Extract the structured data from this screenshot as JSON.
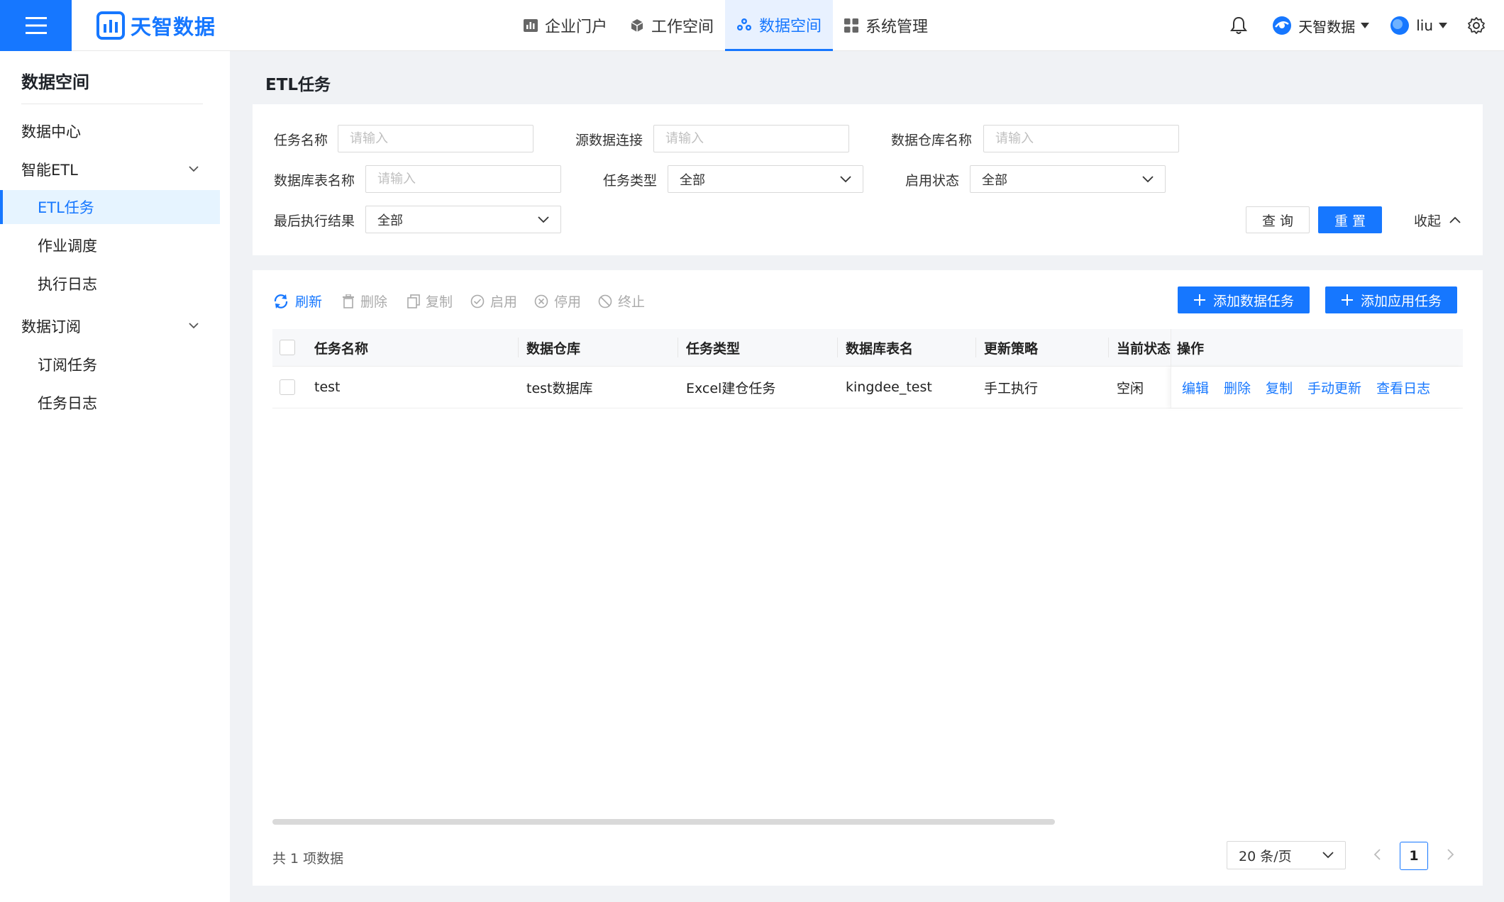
{
  "brand": {
    "name": "天智数据"
  },
  "nav": [
    {
      "label": "企业门户",
      "icon": "bar-chart-icon"
    },
    {
      "label": "工作空间",
      "icon": "cube-icon"
    },
    {
      "label": "数据空间",
      "icon": "data-nodes-icon",
      "active": true
    },
    {
      "label": "系统管理",
      "icon": "grid-icon"
    }
  ],
  "header_right": {
    "org": "天智数据",
    "user": "liu"
  },
  "sidebar": {
    "title": "数据空间",
    "items": [
      {
        "label": "数据中心",
        "level": 1
      },
      {
        "label": "智能ETL",
        "level": 1,
        "expandable": true
      },
      {
        "label": "ETL任务",
        "level": 2,
        "active": true
      },
      {
        "label": "作业调度",
        "level": 2
      },
      {
        "label": "执行日志",
        "level": 2
      },
      {
        "label": "数据订阅",
        "level": 1,
        "expandable": true
      },
      {
        "label": "订阅任务",
        "level": 2
      },
      {
        "label": "任务日志",
        "level": 2
      }
    ]
  },
  "page": {
    "title": "ETL任务"
  },
  "filters": {
    "task_name": {
      "label": "任务名称",
      "placeholder": "请输入"
    },
    "source_conn": {
      "label": "源数据连接",
      "placeholder": "请输入"
    },
    "warehouse_name": {
      "label": "数据仓库名称",
      "placeholder": "请输入"
    },
    "table_name": {
      "label": "数据库表名称",
      "placeholder": "请输入"
    },
    "task_type": {
      "label": "任务类型",
      "value": "全部"
    },
    "enable_status": {
      "label": "启用状态",
      "value": "全部"
    },
    "last_result": {
      "label": "最后执行结果",
      "value": "全部"
    },
    "query_label": "查 询",
    "reset_label": "重 置",
    "collapse_label": "收起"
  },
  "toolbar": {
    "refresh": "刷新",
    "delete": "删除",
    "copy": "复制",
    "enable": "启用",
    "disable": "停用",
    "terminate": "终止",
    "add_data_task": "添加数据任务",
    "add_app_task": "添加应用任务"
  },
  "table": {
    "columns": [
      "任务名称",
      "数据仓库",
      "任务类型",
      "数据库表名",
      "更新策略",
      "当前状态",
      "操作"
    ],
    "rows": [
      {
        "name": "test",
        "warehouse": "test数据库",
        "type": "Excel建仓任务",
        "table": "kingdee_test",
        "strategy": "手工执行",
        "status": "空闲",
        "ops": [
          "编辑",
          "删除",
          "复制",
          "手动更新",
          "查看日志"
        ]
      }
    ]
  },
  "pagination": {
    "total_text": "共 1 项数据",
    "page_size": "20 条/页",
    "current_page": "1"
  },
  "colors": {
    "primary": "#1677ff",
    "bg": "#f0f2f5"
  }
}
